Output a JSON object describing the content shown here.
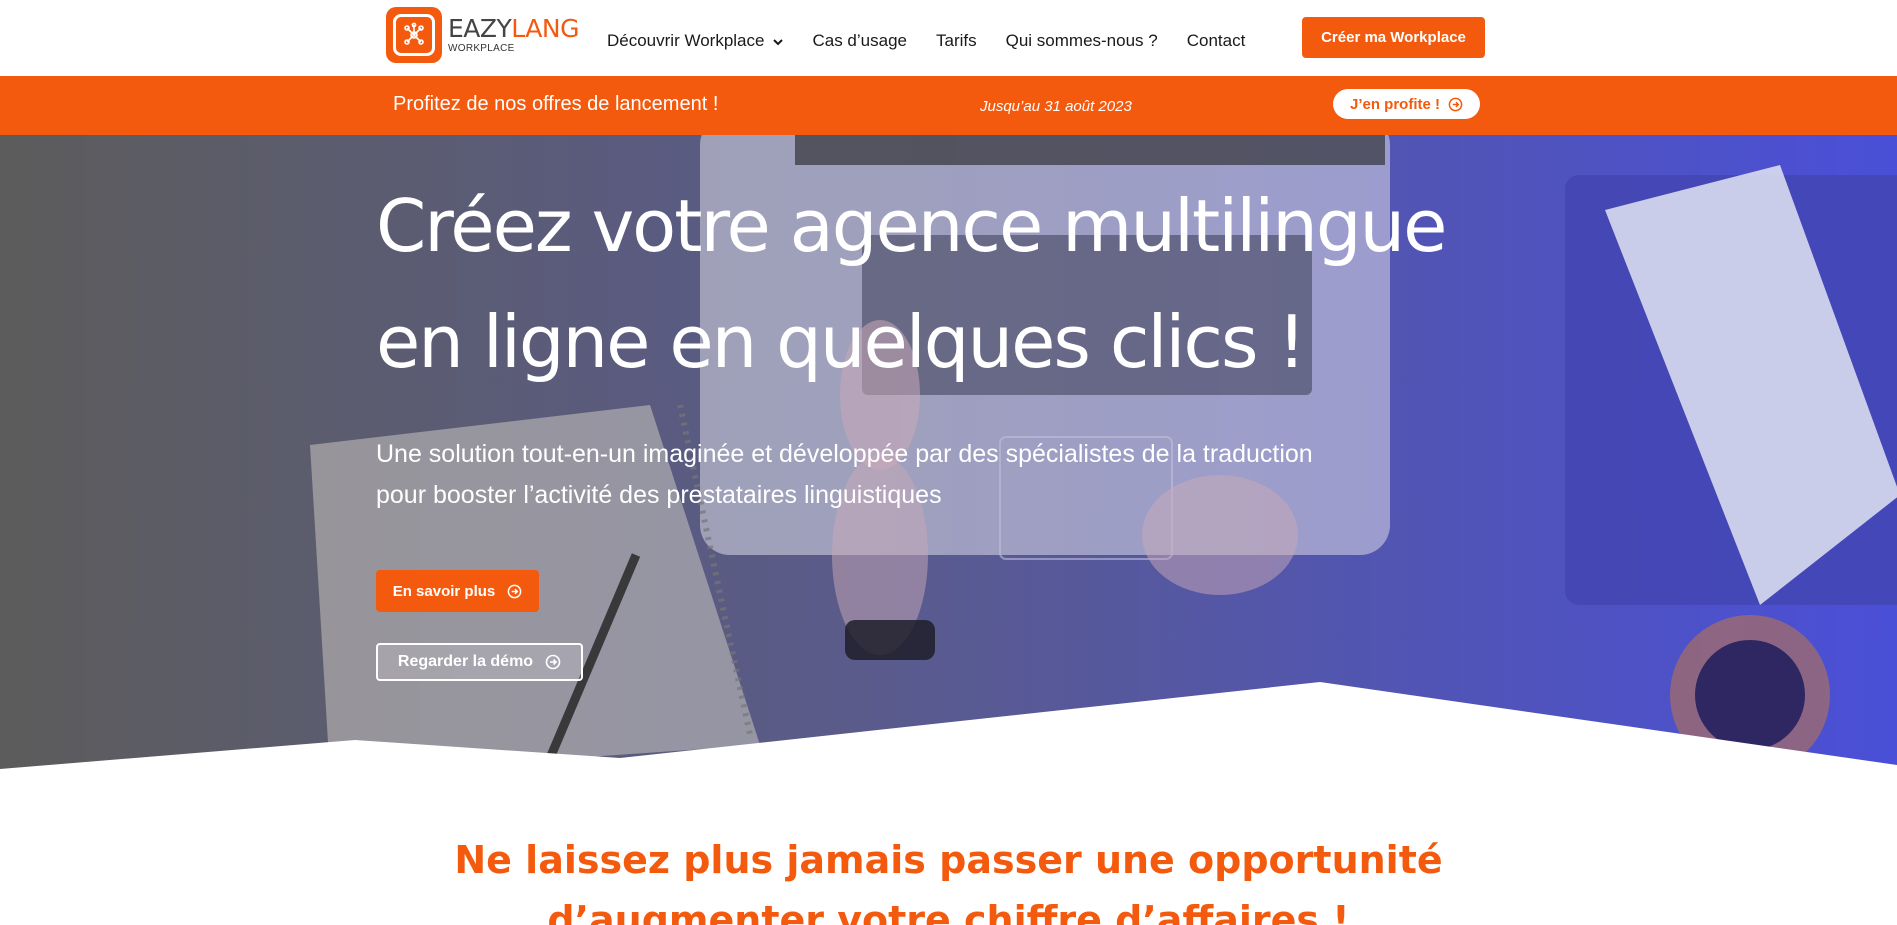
{
  "brand": {
    "name_part1": "EAZY",
    "name_part2": "LANG",
    "sub": "WORKPLACE",
    "logo_icon": "network-nodes-icon",
    "accent_color": "#f45a0e"
  },
  "nav": {
    "items": [
      {
        "label": "Découvrir Workplace",
        "has_dropdown": true
      },
      {
        "label": "Cas d’usage"
      },
      {
        "label": "Tarifs"
      },
      {
        "label": "Qui sommes-nous ?"
      },
      {
        "label": "Contact"
      }
    ],
    "cta_label": "Créer ma Workplace"
  },
  "promo": {
    "text": "Profitez de nos offres de lancement !",
    "date": "Jusqu’au 31 août 2023",
    "button_label": "J’en profite !",
    "button_icon": "arrow-circle-right-icon"
  },
  "hero": {
    "title_line1": "Créez votre agence multilingue",
    "title_line2": "en ligne en quelques clics !",
    "subtitle_line1": "Une solution tout-en-un imaginée et développée par des spécialistes de la traduction",
    "subtitle_line2": "pour booster l’activité des prestataires linguistiques",
    "primary_button": "En savoir plus",
    "secondary_button": "Regarder la démo",
    "button_icon": "arrow-circle-right-icon",
    "background_description_colors": {
      "left": "#5a5a5a",
      "right": "#4c4fd4"
    }
  },
  "section": {
    "title_line1": "Ne laissez plus jamais passer une opportunité",
    "title_line2": "d’augmenter votre chiffre d’affaires !"
  }
}
